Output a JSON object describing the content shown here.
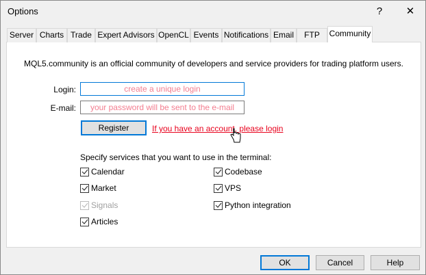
{
  "window": {
    "title": "Options",
    "help_label": "?",
    "close_label": "✕"
  },
  "tabs": [
    "Server",
    "Charts",
    "Trade",
    "Expert Advisors",
    "OpenCL",
    "Events",
    "Notifications",
    "Email",
    "FTP",
    "Community"
  ],
  "active_tab": "Community",
  "community": {
    "description": "MQL5.community is an official community of developers and service providers for trading platform users.",
    "login_label": "Login:",
    "login_placeholder": "create a unique login",
    "email_label": "E-mail:",
    "email_placeholder": "your password will be sent to the e-mail",
    "register_label": "Register",
    "login_link": "If you have an account, please login",
    "services_label": "Specify services that you want to use in the terminal:",
    "services": [
      {
        "label": "Calendar",
        "checked": true,
        "enabled": true
      },
      {
        "label": "Market",
        "checked": true,
        "enabled": true
      },
      {
        "label": "Signals",
        "checked": true,
        "enabled": false
      },
      {
        "label": "Articles",
        "checked": true,
        "enabled": true
      },
      {
        "label": "Codebase",
        "checked": true,
        "enabled": true
      },
      {
        "label": "VPS",
        "checked": true,
        "enabled": true
      },
      {
        "label": "Python integration",
        "checked": true,
        "enabled": true
      }
    ]
  },
  "footer": {
    "ok": "OK",
    "cancel": "Cancel",
    "help": "Help"
  }
}
